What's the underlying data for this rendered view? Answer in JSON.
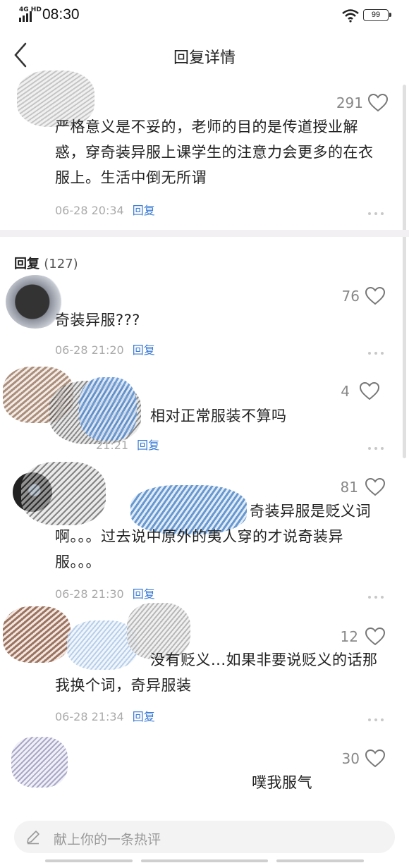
{
  "status_bar": {
    "network": "4G HD",
    "time": "08:30",
    "battery": "99"
  },
  "header": {
    "title": "回复详情"
  },
  "main_comment": {
    "likes": "291",
    "text": "严格意义是不妥的，老师的目的是传道授业解惑，穿奇装异服上课学生的注意力会更多的在衣服上。生活中倒无所谓",
    "time": "06-28 20:34",
    "reply_label": "回复"
  },
  "replies_section": {
    "label": "回复",
    "count": "(127)"
  },
  "replies": [
    {
      "likes": "76",
      "text": "奇装异服???",
      "time": "06-28 21:20",
      "reply_label": "回复"
    },
    {
      "likes": "4",
      "text": "相对正常服装不算吗",
      "time": "21:21",
      "reply_label": "回复"
    },
    {
      "likes": "81",
      "text": "奇装异服是贬义词啊。。。过去说中原外的夷人穿的才说奇装异服。。。",
      "time": "06-28 21:30",
      "reply_label": "回复"
    },
    {
      "likes": "12",
      "text": "没有贬义...如果非要说贬义的话那我换个词，奇异服装",
      "time": "06-28 21:34",
      "reply_label": "回复"
    },
    {
      "likes": "30",
      "text": "噗我服气",
      "time": "",
      "reply_label": ""
    }
  ],
  "input": {
    "placeholder": "献上你的一条热评"
  },
  "colors": {
    "accent": "#3a7bd5",
    "meta": "#aaaaaa",
    "divider": "#f2f0f3"
  }
}
